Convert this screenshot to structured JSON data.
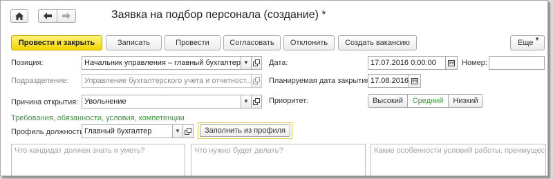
{
  "window": {
    "title": "Заявка на подбор персонала (создание) *"
  },
  "nav": {
    "home_icon": "home-icon",
    "back_icon": "arrow-left-icon",
    "forward_icon": "arrow-right-icon"
  },
  "toolbar": {
    "post_and_close": "Провести и закрыть",
    "save": "Записать",
    "post": "Провести",
    "approve": "Согласовать",
    "reject": "Отклонить",
    "create_vacancy": "Создать вакансию",
    "more": "Еще"
  },
  "form": {
    "position_label": "Позиция:",
    "position_value": "Начальник управления – главный бухгалтер / ...",
    "department_label": "Подразделение:",
    "department_value": "Управление бухгалтерского учета и отчетност...",
    "reason_label": "Причина открытия:",
    "reason_value": "Увольнение",
    "date_label": "Дата:",
    "date_value": "17.07.2016  0:00:00",
    "number_label": "Номер:",
    "number_value": "",
    "planned_close_label": "Планируемая дата закрытия:",
    "planned_close_value": "17.08.2016",
    "priority_label": "Приоритет:",
    "priority_options": [
      "Высокий",
      "Средний",
      "Низкий"
    ],
    "priority_selected": "Средний",
    "requirements_link": "Требования, обязанности, условия, компетенции",
    "profile_label": "Профиль должности:",
    "profile_value": "Главный бухгалтер",
    "fill_from_profile": "Заполнить из профиля",
    "text1_placeholder": "Что кандидат должен знать и уметь?",
    "text2_placeholder": "Что нужно будет делать?",
    "text3_placeholder": "Какие особенности условий работы, преимущес..."
  },
  "colors": {
    "accent_yellow": "#f2d400",
    "link_green": "#3a9a3a"
  }
}
